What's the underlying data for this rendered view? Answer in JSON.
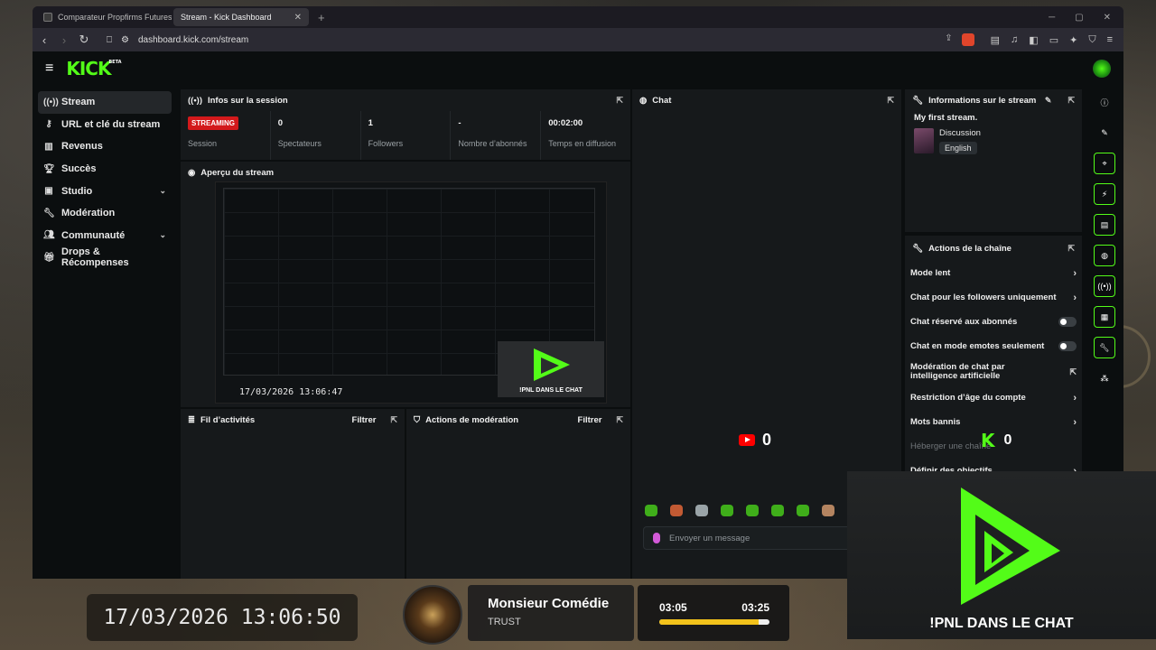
{
  "browser": {
    "tabs": [
      {
        "label": "Comparateur Propfirms Futures 2026",
        "active": false
      },
      {
        "label": "Stream - Kick Dashboard",
        "active": true
      }
    ],
    "new_tab": "+",
    "url": "dashboard.kick.com/stream"
  },
  "kick": {
    "logo": "KICK",
    "logo_badge": "BETA",
    "sidebar": [
      {
        "label": "Stream",
        "icon": "broadcast-icon",
        "glyph": "((•))",
        "active": true
      },
      {
        "label": "URL et clé du stream",
        "icon": "key-icon",
        "glyph": "⚷"
      },
      {
        "label": "Revenus",
        "icon": "chart-icon",
        "glyph": "▥"
      },
      {
        "label": "Succès",
        "icon": "trophy-icon",
        "glyph": "🏆︎"
      },
      {
        "label": "Studio",
        "icon": "studio-icon",
        "glyph": "▣",
        "expandable": true
      },
      {
        "label": "Modération",
        "icon": "wrench-icon",
        "glyph": "🔧︎"
      },
      {
        "label": "Communauté",
        "icon": "people-icon",
        "glyph": "👥︎",
        "expandable": true
      },
      {
        "label": "Drops & Récompenses",
        "icon": "gift-icon",
        "glyph": "🎁︎"
      }
    ],
    "session": {
      "title": "Infos sur la session",
      "badge": "STREAMING",
      "stats": [
        {
          "value": "",
          "label": "Session"
        },
        {
          "value": "0",
          "label": "Spectateurs"
        },
        {
          "value": "1",
          "label": "Followers"
        },
        {
          "value": "-",
          "label": "Nombre d’abonnés"
        },
        {
          "value": "00:02:00",
          "label": "Temps en diffusion"
        }
      ]
    },
    "preview": {
      "title": "Aperçu du stream",
      "timestamp": "17/03/2026 13:06:47",
      "cta": "!PNL DANS LE CHAT"
    },
    "activity": {
      "title": "Fil d’activités",
      "filter": "Filtrer"
    },
    "mod_actions": {
      "title": "Actions de modération",
      "filter": "Filtrer"
    },
    "chat": {
      "title": "Chat",
      "placeholder": "Envoyer un message"
    },
    "stream_info": {
      "title": "Informations sur le stream",
      "stream_title": "My first stream.",
      "category": "Discussion",
      "language": "English"
    },
    "channel_actions": {
      "title": "Actions de la chaîne",
      "items": [
        {
          "label": "Mode lent",
          "control": "arrow"
        },
        {
          "label": "Chat pour les followers uniquement",
          "control": "arrow"
        },
        {
          "label": "Chat réservé aux abonnés",
          "control": "toggle",
          "on": false
        },
        {
          "label": "Chat en mode emotes seulement",
          "control": "toggle",
          "on": false
        },
        {
          "label": "Modération de chat par intelligence artificielle",
          "control": "external"
        },
        {
          "label": "Restriction d’âge du compte",
          "control": "arrow"
        },
        {
          "label": "Mots bannis",
          "control": "arrow"
        },
        {
          "label": "Héberger une chaîne",
          "control": "none",
          "dim": true
        },
        {
          "label": "Définir des objectifs",
          "control": "arrow"
        }
      ]
    }
  },
  "overlay": {
    "youtube_viewers": "0",
    "kick_viewers": "0",
    "cta": "!PNL DANS LE CHAT",
    "clock": "17/03/2026 13:06:50",
    "track_title": "Monsieur Comédie",
    "track_artist": "TRUST",
    "elapsed": "03:05",
    "duration": "03:25",
    "progress_fraction": 0.9
  },
  "colors": {
    "kick_green": "#53fc18",
    "live_red": "#d3191b",
    "youtube_red": "#ff0000",
    "progress_yellow": "#f2c21b"
  }
}
